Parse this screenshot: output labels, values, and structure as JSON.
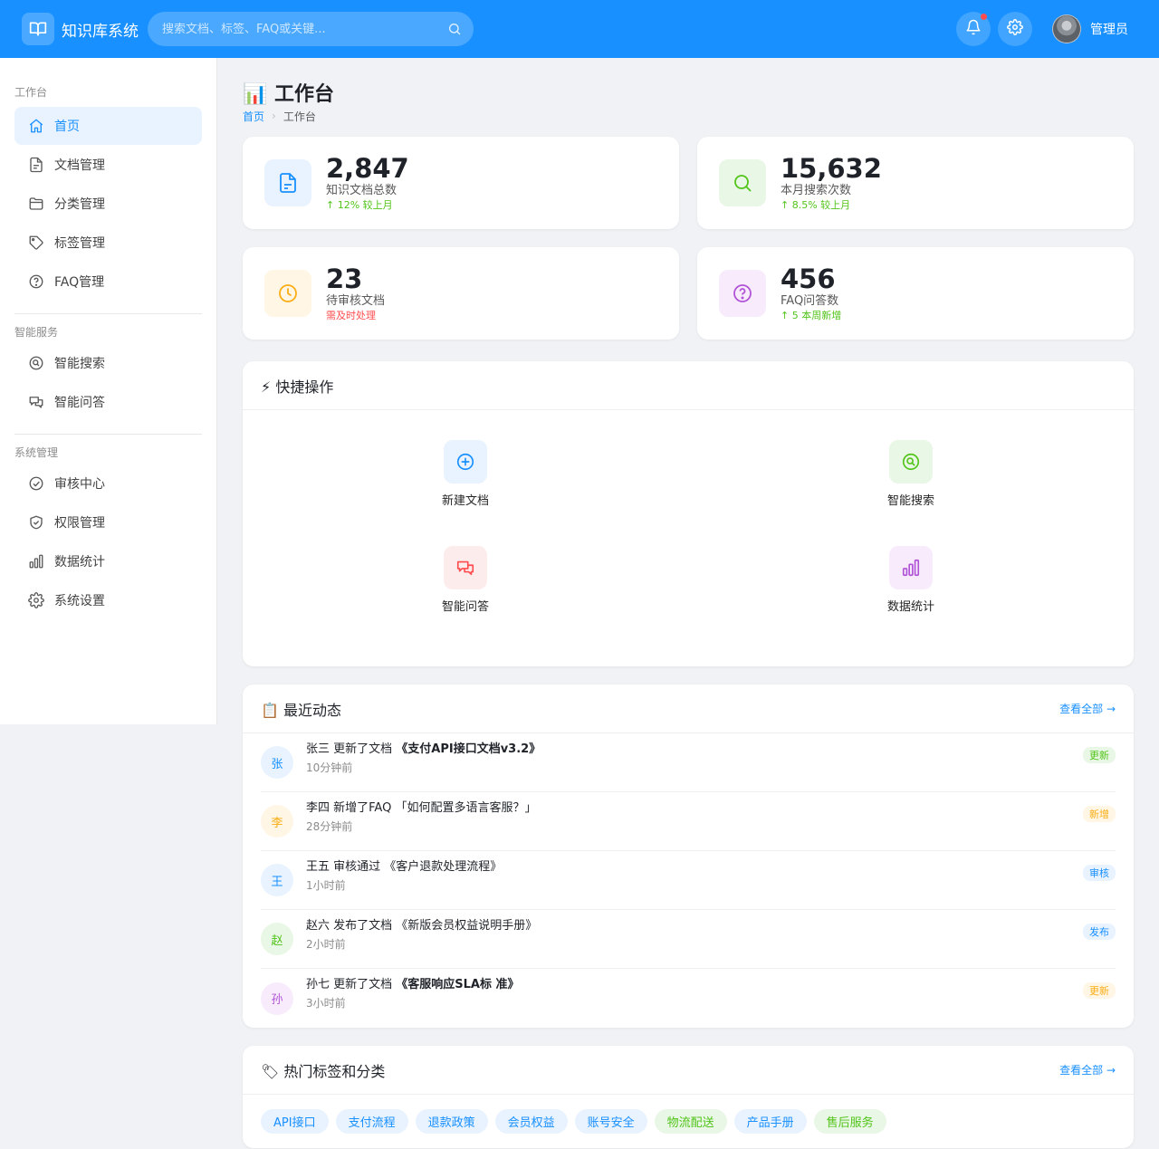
{
  "app": {
    "name": "知识库系统",
    "logo_icon": "book-open-icon"
  },
  "header": {
    "search_placeholder": "搜索文档、标签、FAQ或关键...",
    "user_name": "管理员"
  },
  "colors": {
    "primary": "#1890ff",
    "success": "#52c41a",
    "warning": "#faad14",
    "danger": "#ff4d4f",
    "purple": "#b154d6"
  },
  "sidebar": {
    "groups": [
      {
        "title": "工作台",
        "items": [
          {
            "label": "首页",
            "icon": "home-icon",
            "active": true
          },
          {
            "label": "文档管理",
            "icon": "document-icon"
          },
          {
            "label": "分类管理",
            "icon": "folder-icon"
          },
          {
            "label": "标签管理",
            "icon": "tag-icon"
          },
          {
            "label": "FAQ管理",
            "icon": "question-icon"
          }
        ]
      },
      {
        "title": "智能服务",
        "items": [
          {
            "label": "智能搜索",
            "icon": "search-circle-icon"
          },
          {
            "label": "智能问答",
            "icon": "chat-icon"
          }
        ]
      },
      {
        "title": "系统管理",
        "items": [
          {
            "label": "审核中心",
            "icon": "check-circle-icon"
          },
          {
            "label": "权限管理",
            "icon": "shield-icon"
          },
          {
            "label": "数据统计",
            "icon": "bar-chart-icon"
          },
          {
            "label": "系统设置",
            "icon": "gear-icon"
          }
        ]
      }
    ]
  },
  "page": {
    "title": "📊 工作台",
    "breadcrumb": {
      "home": "首页",
      "current": "工作台"
    }
  },
  "stats": [
    {
      "value": "2,847",
      "label": "知识文档总数",
      "trend": "↑ 12% 较上月",
      "trend_color": "#52c41a",
      "icon": "document-icon",
      "icon_color": "#1890ff",
      "icon_bg": "#e8f3ff"
    },
    {
      "value": "15,632",
      "label": "本月搜索次数",
      "trend": "↑ 8.5% 较上月",
      "trend_color": "#52c41a",
      "icon": "search-icon",
      "icon_color": "#52c41a",
      "icon_bg": "#e9f7e6"
    },
    {
      "value": "23",
      "label": "待审核文档",
      "trend": "需及时处理",
      "trend_color": "#ff4d4f",
      "icon": "clock-icon",
      "icon_color": "#faad14",
      "icon_bg": "#fff6e6"
    },
    {
      "value": "456",
      "label": "FAQ问答数",
      "trend": "↑ 5 本周新增",
      "trend_color": "#52c41a",
      "icon": "question-icon",
      "icon_color": "#b154d6",
      "icon_bg": "#f7ebfc"
    }
  ],
  "quick_actions": {
    "title": "⚡ 快捷操作",
    "items": [
      {
        "label": "新建文档",
        "icon": "plus-circle-icon",
        "color": "#1890ff",
        "bg": "#e8f3ff"
      },
      {
        "label": "智能搜索",
        "icon": "search-circle-icon",
        "color": "#52c41a",
        "bg": "#e9f7e6"
      },
      {
        "label": "智能问答",
        "icon": "chat-icon",
        "color": "#ff4d4f",
        "bg": "#fdecec"
      },
      {
        "label": "数据统计",
        "icon": "bar-chart-icon",
        "color": "#b154d6",
        "bg": "#f7ebfc"
      }
    ]
  },
  "activity": {
    "title": "📋 最近动态",
    "more": "查看全部 →",
    "items": [
      {
        "avatar": "张",
        "avatar_color": "#1890ff",
        "avatar_bg": "#e8f3ff",
        "prefix": "张三 更新了文档 ",
        "bold": "《支付API接口文档v3.2》",
        "suffix": "",
        "time": "10分钟前",
        "badge": "更新",
        "badge_color": "#52c41a",
        "badge_bg": "#e9f7e6"
      },
      {
        "avatar": "李",
        "avatar_color": "#faad14",
        "avatar_bg": "#fff6e6",
        "prefix": "李四 新增了FAQ ",
        "bold": "",
        "suffix": "「如何配置多语言客服？」",
        "time": "28分钟前",
        "badge": "新增",
        "badge_color": "#faad14",
        "badge_bg": "#fff6e6"
      },
      {
        "avatar": "王",
        "avatar_color": "#1890ff",
        "avatar_bg": "#e8f3ff",
        "prefix": "王五 审核通过 ",
        "bold": "",
        "suffix": "《客户退款处理流程》",
        "time": "1小时前",
        "badge": "审核",
        "badge_color": "#1890ff",
        "badge_bg": "#e8f3ff"
      },
      {
        "avatar": "赵",
        "avatar_color": "#52c41a",
        "avatar_bg": "#e9f7e6",
        "prefix": "赵六 发布了文档 ",
        "bold": "",
        "suffix": "《新版会员权益说明手册》",
        "time": "2小时前",
        "badge": "发布",
        "badge_color": "#1890ff",
        "badge_bg": "#e8f3ff"
      },
      {
        "avatar": "孙",
        "avatar_color": "#b154d6",
        "avatar_bg": "#f7ebfc",
        "prefix": "孙七 更新了文档 ",
        "bold": "《客服响应SLA标 准》",
        "suffix": "",
        "time": "3小时前",
        "badge": "更新",
        "badge_color": "#faad14",
        "badge_bg": "#fff6e6"
      }
    ]
  },
  "tags_card": {
    "title": "🏷 热门标签和分类",
    "more": "查看全部 →",
    "tags": [
      {
        "label": "API接口",
        "color": "#1890ff",
        "bg": "#e8f3ff"
      },
      {
        "label": "支付流程",
        "color": "#1890ff",
        "bg": "#e8f3ff"
      },
      {
        "label": "退款政策",
        "color": "#1890ff",
        "bg": "#e8f3ff"
      },
      {
        "label": "会员权益",
        "color": "#1890ff",
        "bg": "#e8f3ff"
      },
      {
        "label": "账号安全",
        "color": "#1890ff",
        "bg": "#e8f3ff"
      },
      {
        "label": "物流配送",
        "color": "#52c41a",
        "bg": "#e9f7e6"
      },
      {
        "label": "产品手册",
        "color": "#1890ff",
        "bg": "#e8f3ff"
      },
      {
        "label": "售后服务",
        "color": "#52c41a",
        "bg": "#e9f7e6"
      }
    ]
  }
}
